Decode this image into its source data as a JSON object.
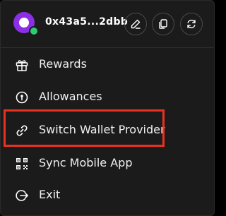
{
  "wallet": {
    "address": "0x43a5...2dbb",
    "avatar_color": "#8b2fe6",
    "status_color": "#2ecc71"
  },
  "header_actions": [
    {
      "icon": "edit-icon"
    },
    {
      "icon": "copy-icon"
    },
    {
      "icon": "refresh-icon"
    }
  ],
  "menu": {
    "items": [
      {
        "label": "Rewards",
        "icon": "gift-icon"
      },
      {
        "label": "Allowances",
        "icon": "allowance-icon"
      },
      {
        "label": "Switch Wallet Provider",
        "icon": "link-icon"
      },
      {
        "label": "Sync Mobile App",
        "icon": "qr-code-icon"
      },
      {
        "label": "Exit",
        "icon": "exit-icon"
      }
    ]
  },
  "highlight": {
    "color": "#e8321f",
    "target": "Switch Wallet Provider"
  }
}
